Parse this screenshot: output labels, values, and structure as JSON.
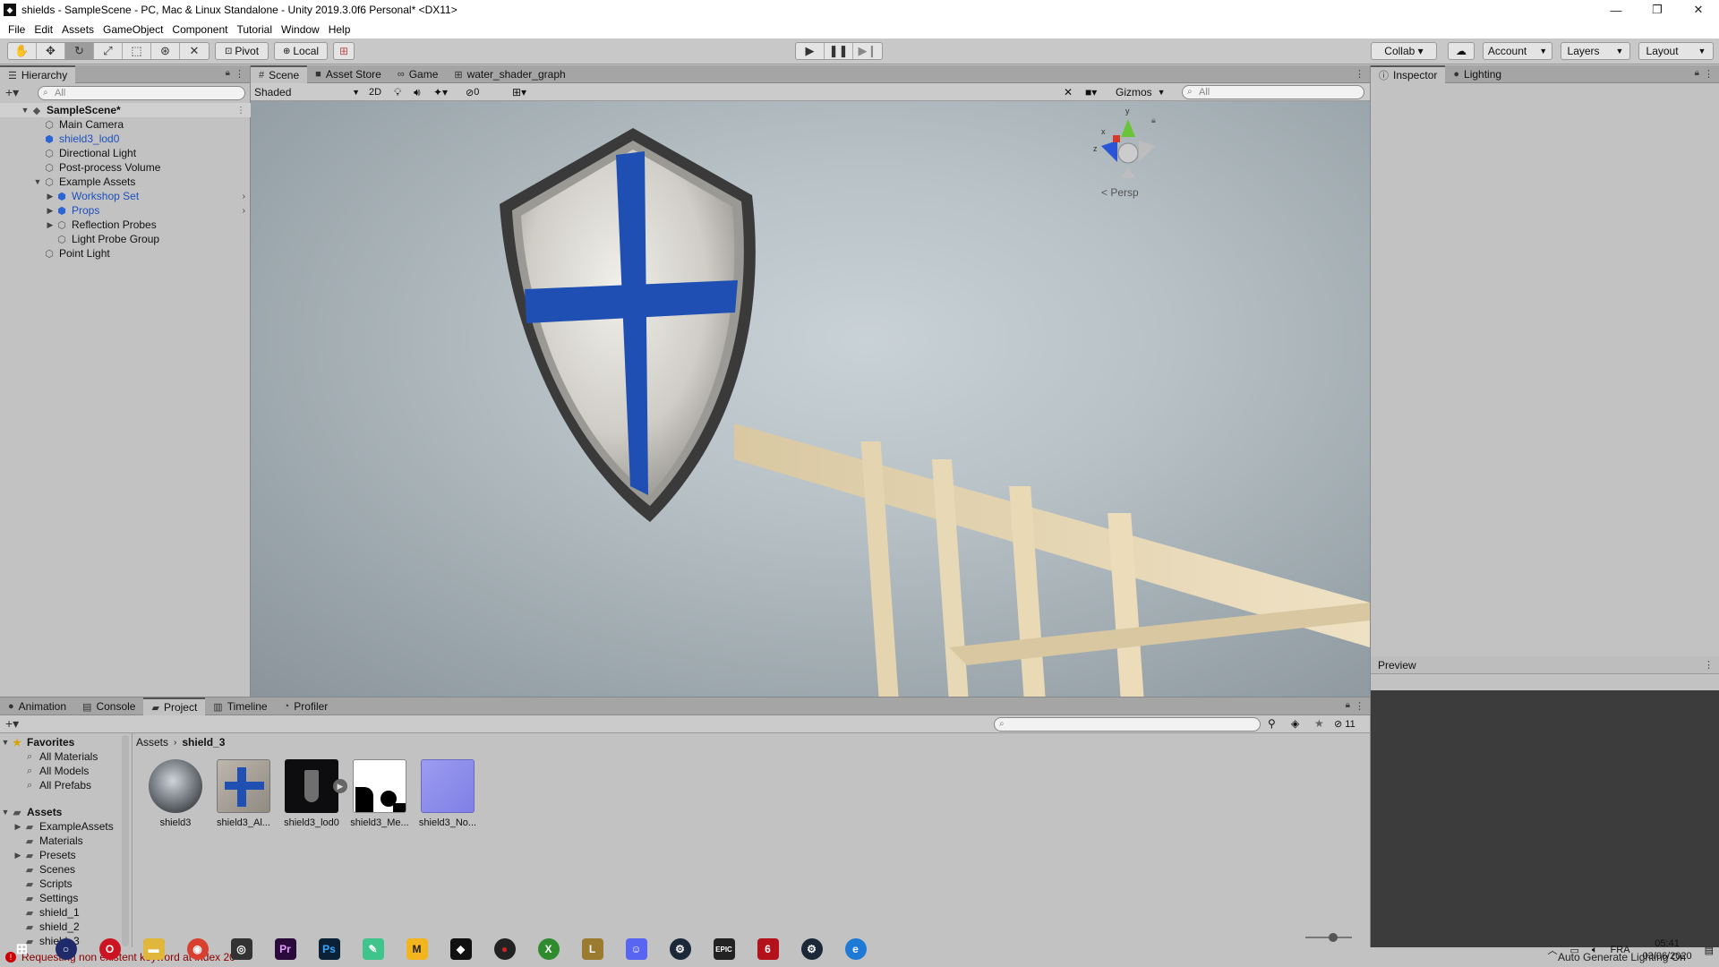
{
  "window": {
    "title": "shields - SampleScene - PC, Mac & Linux Standalone - Unity 2019.3.0f6 Personal* <DX11>",
    "controls": [
      "—",
      "❐",
      "✕"
    ]
  },
  "menu": [
    "File",
    "Edit",
    "Assets",
    "GameObject",
    "Component",
    "Tutorial",
    "Window",
    "Help"
  ],
  "toolbar": {
    "pivot_label": "Pivot",
    "local_label": "Local",
    "collab_label": "Collab ▾",
    "account_label": "Account",
    "layers_label": "Layers",
    "layout_label": "Layout"
  },
  "hierarchy": {
    "tab_label": "Hierarchy",
    "search_placeholder": "All",
    "items": [
      {
        "label": "SampleScene*",
        "depth": 0,
        "expanded": true,
        "type": "scene"
      },
      {
        "label": "Main Camera",
        "depth": 1,
        "type": "go"
      },
      {
        "label": "shield3_lod0",
        "depth": 1,
        "type": "prefab"
      },
      {
        "label": "Directional Light",
        "depth": 1,
        "type": "go"
      },
      {
        "label": "Post-process Volume",
        "depth": 1,
        "type": "go"
      },
      {
        "label": "Example Assets",
        "depth": 1,
        "expanded": true,
        "type": "go"
      },
      {
        "label": "Workshop Set",
        "depth": 2,
        "collapsed": true,
        "type": "prefab"
      },
      {
        "label": "Props",
        "depth": 2,
        "collapsed": true,
        "type": "prefab"
      },
      {
        "label": "Reflection Probes",
        "depth": 2,
        "collapsed": true,
        "type": "go"
      },
      {
        "label": "Light Probe Group",
        "depth": 2,
        "type": "go"
      },
      {
        "label": "Point Light",
        "depth": 1,
        "type": "go"
      }
    ]
  },
  "scene_tabs": [
    {
      "label": "Scene",
      "icon": "#",
      "active": true
    },
    {
      "label": "Asset Store",
      "icon": "■"
    },
    {
      "label": "Game",
      "icon": "∞"
    },
    {
      "label": "water_shader_graph",
      "icon": "⊞"
    }
  ],
  "scene_bar": {
    "shading_mode": "Shaded",
    "mode_2d": "2D",
    "hidden_count": "0",
    "gizmos_label": "Gizmos",
    "search_placeholder": "All"
  },
  "scene_gizmo": {
    "persp_label": "< Persp",
    "y": "y",
    "x": "x",
    "z": "z"
  },
  "inspector_tabs": [
    {
      "label": "Inspector",
      "icon": "ⓘ",
      "active": true
    },
    {
      "label": "Lighting",
      "icon": "●"
    }
  ],
  "preview": {
    "label": "Preview"
  },
  "bottom_tabs": [
    {
      "label": "Animation",
      "icon": "●"
    },
    {
      "label": "Console",
      "icon": "▤"
    },
    {
      "label": "Project",
      "icon": "▰",
      "active": true
    },
    {
      "label": "Timeline",
      "icon": "▥"
    },
    {
      "label": "Profiler",
      "icon": "◔"
    }
  ],
  "project": {
    "hidden_count": "11",
    "favorites_label": "Favorites",
    "favorites": [
      "All Materials",
      "All Models",
      "All Prefabs"
    ],
    "assets_label": "Assets",
    "folders": [
      {
        "label": "ExampleAssets",
        "has_children": true
      },
      {
        "label": "Materials",
        "has_children": false
      },
      {
        "label": "Presets",
        "has_children": true
      },
      {
        "label": "Scenes",
        "has_children": false
      },
      {
        "label": "Scripts",
        "has_children": false
      },
      {
        "label": "Settings",
        "has_children": false
      },
      {
        "label": "shield_1",
        "has_children": false
      },
      {
        "label": "shield_2",
        "has_children": false
      },
      {
        "label": "shield_3",
        "has_children": false
      }
    ],
    "breadcrumb": [
      "Assets",
      "shield_3"
    ],
    "assets": [
      {
        "label": "shield3",
        "kind": "material"
      },
      {
        "label": "shield3_Al...",
        "kind": "albedo"
      },
      {
        "label": "shield3_lod0",
        "kind": "model"
      },
      {
        "label": "shield3_Me...",
        "kind": "metallic"
      },
      {
        "label": "shield3_No...",
        "kind": "normal"
      }
    ]
  },
  "status": {
    "error_text": "Requesting non existent keyword at index 20",
    "right_text": "Auto Generate Lighting On"
  },
  "tray": {
    "lang": "FRA",
    "time": "05:41",
    "date": "03/06/2020"
  },
  "colors": {
    "prefab_blue": "#1c4fbf",
    "editor_bg": "#c2c2c2",
    "error_red": "#cc0000"
  }
}
